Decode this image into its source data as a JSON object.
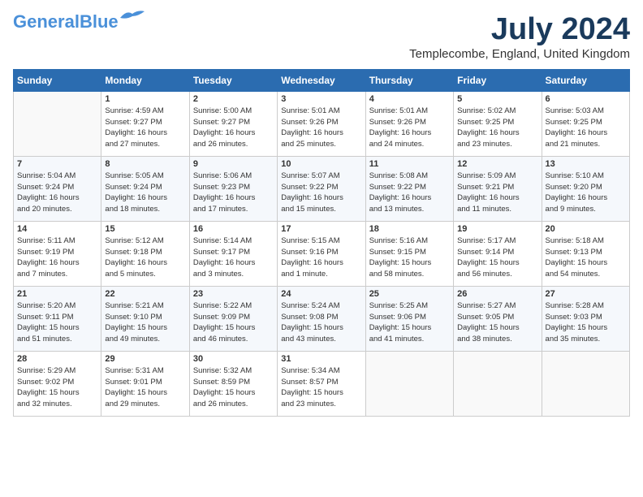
{
  "header": {
    "logo_line1": "General",
    "logo_line2": "Blue",
    "month": "July 2024",
    "location": "Templecombe, England, United Kingdom"
  },
  "days_of_week": [
    "Sunday",
    "Monday",
    "Tuesday",
    "Wednesday",
    "Thursday",
    "Friday",
    "Saturday"
  ],
  "weeks": [
    [
      {
        "day": "",
        "info": ""
      },
      {
        "day": "1",
        "info": "Sunrise: 4:59 AM\nSunset: 9:27 PM\nDaylight: 16 hours\nand 27 minutes."
      },
      {
        "day": "2",
        "info": "Sunrise: 5:00 AM\nSunset: 9:27 PM\nDaylight: 16 hours\nand 26 minutes."
      },
      {
        "day": "3",
        "info": "Sunrise: 5:01 AM\nSunset: 9:26 PM\nDaylight: 16 hours\nand 25 minutes."
      },
      {
        "day": "4",
        "info": "Sunrise: 5:01 AM\nSunset: 9:26 PM\nDaylight: 16 hours\nand 24 minutes."
      },
      {
        "day": "5",
        "info": "Sunrise: 5:02 AM\nSunset: 9:25 PM\nDaylight: 16 hours\nand 23 minutes."
      },
      {
        "day": "6",
        "info": "Sunrise: 5:03 AM\nSunset: 9:25 PM\nDaylight: 16 hours\nand 21 minutes."
      }
    ],
    [
      {
        "day": "7",
        "info": "Sunrise: 5:04 AM\nSunset: 9:24 PM\nDaylight: 16 hours\nand 20 minutes."
      },
      {
        "day": "8",
        "info": "Sunrise: 5:05 AM\nSunset: 9:24 PM\nDaylight: 16 hours\nand 18 minutes."
      },
      {
        "day": "9",
        "info": "Sunrise: 5:06 AM\nSunset: 9:23 PM\nDaylight: 16 hours\nand 17 minutes."
      },
      {
        "day": "10",
        "info": "Sunrise: 5:07 AM\nSunset: 9:22 PM\nDaylight: 16 hours\nand 15 minutes."
      },
      {
        "day": "11",
        "info": "Sunrise: 5:08 AM\nSunset: 9:22 PM\nDaylight: 16 hours\nand 13 minutes."
      },
      {
        "day": "12",
        "info": "Sunrise: 5:09 AM\nSunset: 9:21 PM\nDaylight: 16 hours\nand 11 minutes."
      },
      {
        "day": "13",
        "info": "Sunrise: 5:10 AM\nSunset: 9:20 PM\nDaylight: 16 hours\nand 9 minutes."
      }
    ],
    [
      {
        "day": "14",
        "info": "Sunrise: 5:11 AM\nSunset: 9:19 PM\nDaylight: 16 hours\nand 7 minutes."
      },
      {
        "day": "15",
        "info": "Sunrise: 5:12 AM\nSunset: 9:18 PM\nDaylight: 16 hours\nand 5 minutes."
      },
      {
        "day": "16",
        "info": "Sunrise: 5:14 AM\nSunset: 9:17 PM\nDaylight: 16 hours\nand 3 minutes."
      },
      {
        "day": "17",
        "info": "Sunrise: 5:15 AM\nSunset: 9:16 PM\nDaylight: 16 hours\nand 1 minute."
      },
      {
        "day": "18",
        "info": "Sunrise: 5:16 AM\nSunset: 9:15 PM\nDaylight: 15 hours\nand 58 minutes."
      },
      {
        "day": "19",
        "info": "Sunrise: 5:17 AM\nSunset: 9:14 PM\nDaylight: 15 hours\nand 56 minutes."
      },
      {
        "day": "20",
        "info": "Sunrise: 5:18 AM\nSunset: 9:13 PM\nDaylight: 15 hours\nand 54 minutes."
      }
    ],
    [
      {
        "day": "21",
        "info": "Sunrise: 5:20 AM\nSunset: 9:11 PM\nDaylight: 15 hours\nand 51 minutes."
      },
      {
        "day": "22",
        "info": "Sunrise: 5:21 AM\nSunset: 9:10 PM\nDaylight: 15 hours\nand 49 minutes."
      },
      {
        "day": "23",
        "info": "Sunrise: 5:22 AM\nSunset: 9:09 PM\nDaylight: 15 hours\nand 46 minutes."
      },
      {
        "day": "24",
        "info": "Sunrise: 5:24 AM\nSunset: 9:08 PM\nDaylight: 15 hours\nand 43 minutes."
      },
      {
        "day": "25",
        "info": "Sunrise: 5:25 AM\nSunset: 9:06 PM\nDaylight: 15 hours\nand 41 minutes."
      },
      {
        "day": "26",
        "info": "Sunrise: 5:27 AM\nSunset: 9:05 PM\nDaylight: 15 hours\nand 38 minutes."
      },
      {
        "day": "27",
        "info": "Sunrise: 5:28 AM\nSunset: 9:03 PM\nDaylight: 15 hours\nand 35 minutes."
      }
    ],
    [
      {
        "day": "28",
        "info": "Sunrise: 5:29 AM\nSunset: 9:02 PM\nDaylight: 15 hours\nand 32 minutes."
      },
      {
        "day": "29",
        "info": "Sunrise: 5:31 AM\nSunset: 9:01 PM\nDaylight: 15 hours\nand 29 minutes."
      },
      {
        "day": "30",
        "info": "Sunrise: 5:32 AM\nSunset: 8:59 PM\nDaylight: 15 hours\nand 26 minutes."
      },
      {
        "day": "31",
        "info": "Sunrise: 5:34 AM\nSunset: 8:57 PM\nDaylight: 15 hours\nand 23 minutes."
      },
      {
        "day": "",
        "info": ""
      },
      {
        "day": "",
        "info": ""
      },
      {
        "day": "",
        "info": ""
      }
    ]
  ]
}
